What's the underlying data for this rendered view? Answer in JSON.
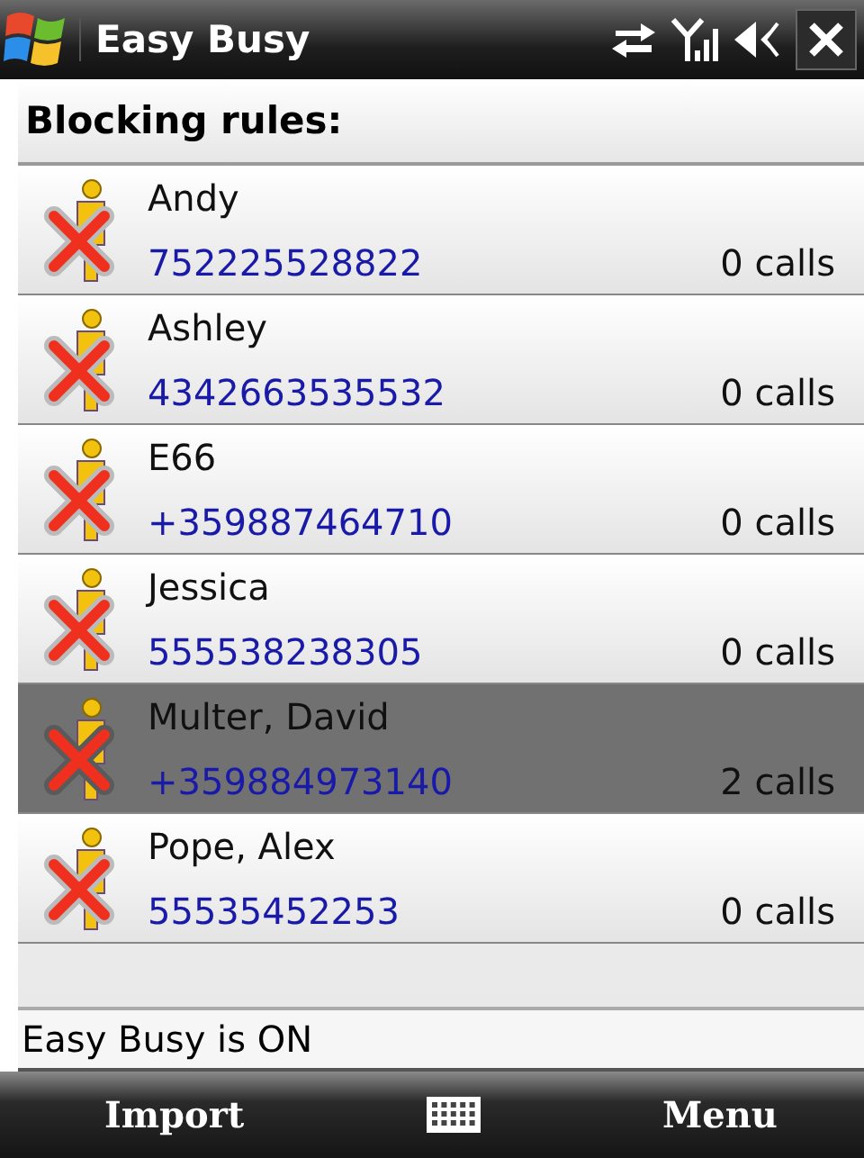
{
  "window": {
    "title": "Easy Busy"
  },
  "header": "Blocking rules:",
  "rules": [
    {
      "name": "Andy",
      "number": "752225528822",
      "calls": "0 calls",
      "selected": false
    },
    {
      "name": "Ashley",
      "number": "4342663535532",
      "calls": "0 calls",
      "selected": false
    },
    {
      "name": "E66",
      "number": "+359887464710",
      "calls": "0 calls",
      "selected": false
    },
    {
      "name": "Jessica",
      "number": "555538238305",
      "calls": "0 calls",
      "selected": false
    },
    {
      "name": "Multer, David",
      "number": "+359884973140",
      "calls": "2 calls",
      "selected": true
    },
    {
      "name": "Pope, Alex",
      "number": "55535452253",
      "calls": "0 calls",
      "selected": false
    }
  ],
  "status": "Easy Busy is ON",
  "softkeys": {
    "left": "Import",
    "right": "Menu"
  }
}
